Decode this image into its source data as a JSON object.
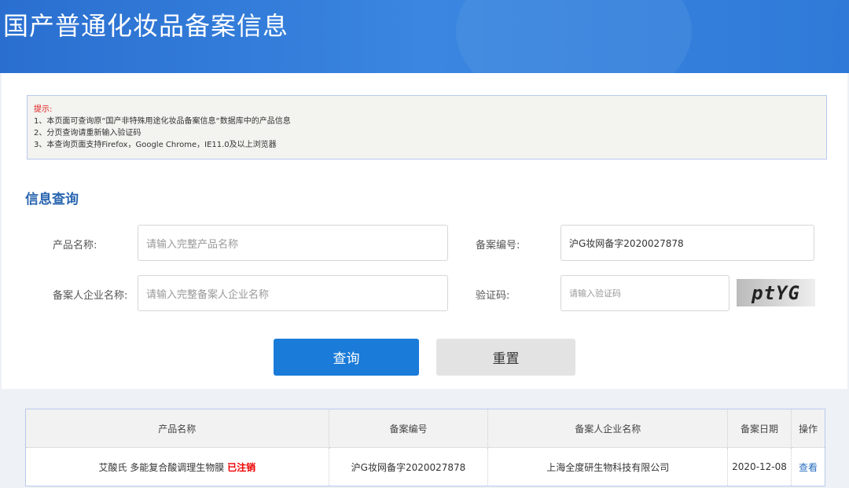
{
  "header": {
    "title": "国产普通化妆品备案信息"
  },
  "tips": {
    "title": "提示:",
    "lines": [
      "1、本页面可查询原“国产非特殊用途化妆品备案信息“数据库中的产品信息",
      "2、分页查询请重新输入验证码",
      "3、本查询页面支持Firefox，Google Chrome，IE11.0及以上浏览器"
    ]
  },
  "search": {
    "title": "信息查询",
    "product_label": "产品名称:",
    "product_placeholder": "请输入完整产品名称",
    "record_label": "备案编号:",
    "record_value": "沪G妆网备字2020027878",
    "company_label": "备案人企业名称:",
    "company_placeholder": "请输入完整备案人企业名称",
    "captcha_label": "验证码:",
    "captcha_placeholder": "请输入验证码",
    "captcha_text": "ptYG",
    "query_button": "查询",
    "reset_button": "重置"
  },
  "table": {
    "headers": [
      "产品名称",
      "备案编号",
      "备案人企业名称",
      "备案日期",
      "操作"
    ],
    "rows": [
      {
        "name": "艾酸氏 多能复合酸调理生物膜",
        "status": "已注销",
        "record": "沪G妆网备字2020027878",
        "company": "上海全度研生物科技有限公司",
        "date": "2020-12-08",
        "action": "查看"
      }
    ]
  },
  "colors": {
    "accent": "#1a7bd8",
    "status_red": "#ee0000"
  }
}
